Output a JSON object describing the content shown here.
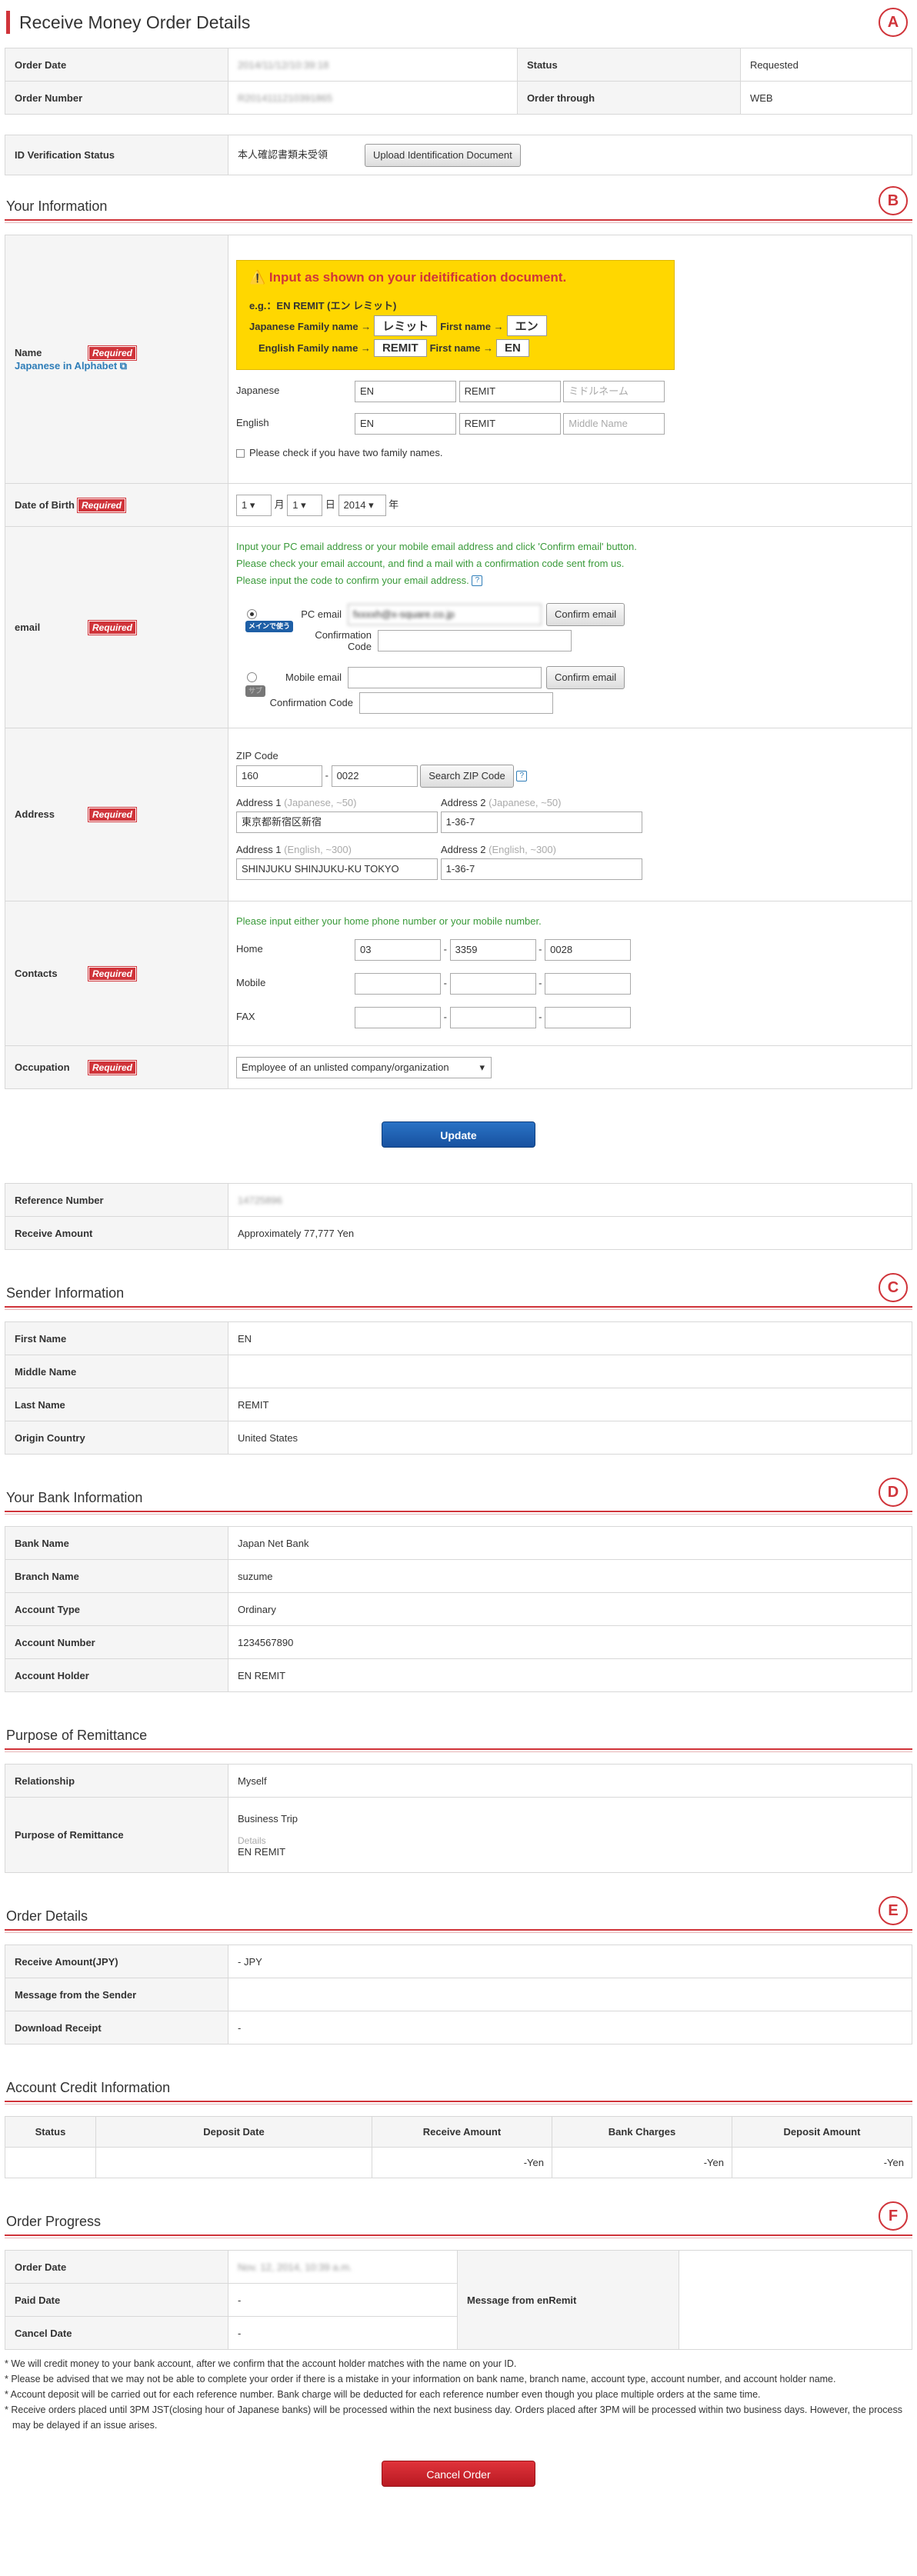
{
  "page_title": "Receive Money Order Details",
  "markers": [
    "A",
    "B",
    "C",
    "D",
    "E",
    "F"
  ],
  "summary": {
    "order_date_label": "Order Date",
    "order_date": "2014/11/12/10:39:18",
    "status_label": "Status",
    "status": "Requested",
    "order_number_label": "Order Number",
    "order_number": "R2014111210391865",
    "order_through_label": "Order through",
    "order_through": "WEB"
  },
  "idv": {
    "label": "ID Verification Status",
    "status": "本人確認書類未受領",
    "button": "Upload Identification Document"
  },
  "your_info": {
    "title": "Your Information",
    "required": "Required",
    "name_label": "Name",
    "name_link": "Japanese in Alphabet",
    "warn": "Input as shown on your ideitification document.",
    "eg": "e.g.：EN REMIT (エン レミット)",
    "jp_family": "Japanese Family name →",
    "jp_family_val": "レミット",
    "jp_first": "First name →",
    "jp_first_val": "エン",
    "en_family": "English Family name →",
    "en_family_val": "REMIT",
    "en_first": "First name →",
    "en_first_val": "EN",
    "japanese": "Japanese",
    "jp_v1": "EN",
    "jp_v2": "REMIT",
    "jp_ph3": "ミドルネーム",
    "english": "English",
    "en_v1": "EN",
    "en_v2": "REMIT",
    "en_ph3": "Middle Name",
    "two_names": "Please check if you have two family names.",
    "dob_label": "Date of Birth",
    "dob_m": "1",
    "dob_mu": "月",
    "dob_d": "1",
    "dob_du": "日",
    "dob_y": "2014",
    "dob_yu": "年",
    "email_label": "email",
    "email_l1": "Input your PC email address or your mobile email address and click 'Confirm email' button.",
    "email_l2": "Please check your email account, and find a mail with a confirmation code sent from us.",
    "email_l3": "Please input the code to confirm your email address.",
    "pc_email": "PC email",
    "pc_email_val": "fxxxxh@x-square.co.jp",
    "confirm": "Confirm email",
    "conf_code": "Confirmation Code",
    "main_badge": "メインで使う",
    "sub_badge": "サブ",
    "mobile_email": "Mobile email",
    "address_label": "Address",
    "zip_label": "ZIP Code",
    "zip1": "160",
    "zip2": "0022",
    "zip_btn": "Search ZIP Code",
    "addr1_l": "Address 1",
    "addr1_h": "(Japanese, ~50)",
    "addr2_l": "Address 2",
    "addr2_h": "(Japanese, ~50)",
    "addr1_jp": "東京都新宿区新宿",
    "addr2_jp": "1-36-7",
    "addr1_en_l": "Address 1",
    "addr1_en_h": "(English, ~300)",
    "addr2_en_l": "Address 2",
    "addr2_en_h": "(English, ~300)",
    "addr1_en": "SHINJUKU SHINJUKU-KU TOKYO",
    "addr2_en": "1-36-7",
    "contacts_label": "Contacts",
    "contacts_note": "Please input either your home phone number or your mobile number.",
    "home": "Home",
    "home1": "03",
    "home2": "3359",
    "home3": "0028",
    "mobile": "Mobile",
    "fax": "FAX",
    "occupation_label": "Occupation",
    "occupation": "Employee of an unlisted company/organization"
  },
  "update_btn": "Update",
  "ref": {
    "label": "Reference Number",
    "value": "14725896",
    "amount_label": "Receive Amount",
    "amount": "Approximately 77,777 Yen"
  },
  "sender": {
    "title": "Sender Information",
    "rows": [
      [
        "First Name",
        "EN"
      ],
      [
        "Middle Name",
        ""
      ],
      [
        "Last Name",
        "REMIT"
      ],
      [
        "Origin Country",
        "United States"
      ]
    ]
  },
  "bank": {
    "title": "Your Bank Information",
    "rows": [
      [
        "Bank Name",
        "Japan Net Bank"
      ],
      [
        "Branch Name",
        "suzume"
      ],
      [
        "Account Type",
        "Ordinary"
      ],
      [
        "Account Number",
        "1234567890"
      ],
      [
        "Account Holder",
        "EN REMIT"
      ]
    ]
  },
  "purpose": {
    "title": "Purpose of Remittance",
    "rel_label": "Relationship",
    "rel": "Myself",
    "purpose_label": "Purpose of Remittance",
    "purpose": "Business Trip",
    "details_label": "Details",
    "details": "EN REMIT"
  },
  "order": {
    "title": "Order Details",
    "rows": [
      [
        "Receive Amount(JPY)",
        "- JPY"
      ],
      [
        "Message from the Sender",
        ""
      ],
      [
        "Download Receipt",
        "-"
      ]
    ]
  },
  "credit": {
    "title": "Account Credit Information",
    "headers": [
      "Status",
      "Deposit Date",
      "Receive Amount",
      "Bank Charges",
      "Deposit Amount"
    ],
    "row": [
      "",
      "",
      "-Yen",
      "-Yen",
      "-Yen"
    ]
  },
  "progress": {
    "title": "Order Progress",
    "order_date_label": "Order Date",
    "order_date": "Nov. 12, 2014, 10:39 a.m.",
    "paid_label": "Paid Date",
    "paid": "-",
    "cancel_label": "Cancel Date",
    "cancel": "-",
    "msg_label": "Message from enRemit"
  },
  "notes": [
    "* We will credit money to your bank account, after we confirm that the account holder matches with the name on your ID.",
    "* Please be advised that we may not be able to complete your order if there is a mistake in your information on bank name, branch name, account type, account number, and account holder name.",
    "* Account deposit will be carried out for each reference number. Bank charge will be deducted for each reference number even though you place multiple orders at the same time.",
    "* Receive orders placed until 3PM JST(closing hour of Japanese banks) will be processed within the next business day. Orders placed after 3PM will be processed within two business days. However, the process may be delayed if an issue arises."
  ],
  "cancel_btn": "Cancel Order",
  "colors": {
    "accent": "#d0343a",
    "primary_button": "#1751a0",
    "warning_bg": "#ffd700",
    "note_green": "#3a9a3a"
  }
}
